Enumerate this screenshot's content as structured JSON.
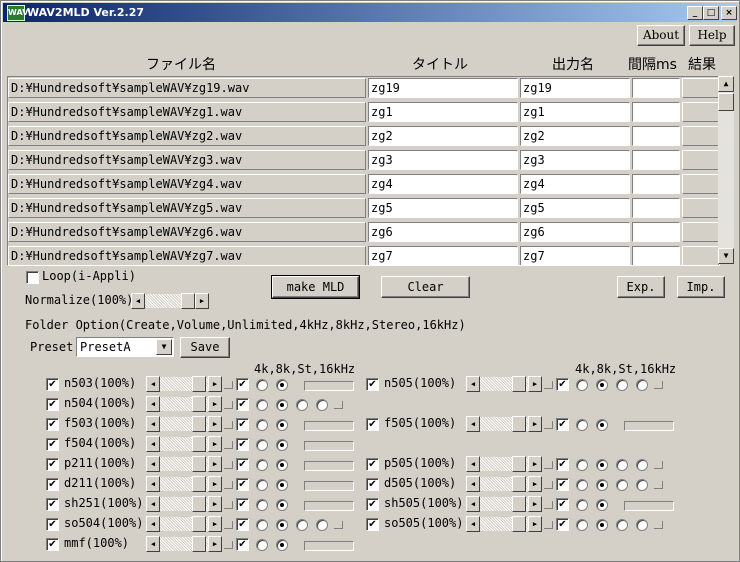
{
  "window": {
    "title": "WAV2MLD Ver.2.27",
    "icon_text": "WAV"
  },
  "controls": {
    "minimize": "_",
    "maximize": "□",
    "close": "×"
  },
  "menu": {
    "about": "About",
    "help": "Help"
  },
  "columns": {
    "file": "ファイル名",
    "title": "タイトル",
    "output": "出力名",
    "interval": "間隔ms",
    "result": "結果"
  },
  "files": [
    {
      "path": "D:¥Hundredsoft¥sampleWAV¥zg19.wav",
      "title": "zg19",
      "output": "zg19"
    },
    {
      "path": "D:¥Hundredsoft¥sampleWAV¥zg1.wav",
      "title": "zg1",
      "output": "zg1"
    },
    {
      "path": "D:¥Hundredsoft¥sampleWAV¥zg2.wav",
      "title": "zg2",
      "output": "zg2"
    },
    {
      "path": "D:¥Hundredsoft¥sampleWAV¥zg3.wav",
      "title": "zg3",
      "output": "zg3"
    },
    {
      "path": "D:¥Hundredsoft¥sampleWAV¥zg4.wav",
      "title": "zg4",
      "output": "zg4"
    },
    {
      "path": "D:¥Hundredsoft¥sampleWAV¥zg5.wav",
      "title": "zg5",
      "output": "zg5"
    },
    {
      "path": "D:¥Hundredsoft¥sampleWAV¥zg6.wav",
      "title": "zg6",
      "output": "zg6"
    },
    {
      "path": "D:¥Hundredsoft¥sampleWAV¥zg7.wav",
      "title": "zg7",
      "output": "zg7"
    }
  ],
  "options": {
    "loop_label": "Loop(i-Appli)",
    "normalize_label": "Normalize(100%)",
    "make_mld": "make MLD",
    "clear": "Clear",
    "exp": "Exp.",
    "imp": "Imp.",
    "folder_option": "Folder Option(Create,Volume,Unlimited,4kHz,8kHz,Stereo,16kHz)",
    "preset_label": "Preset",
    "preset_value": "PresetA",
    "save": "Save",
    "freq_header": "4k,8k,St,16kHz"
  },
  "left_devices": [
    {
      "name": "n503(100%)",
      "radios": 2,
      "sel": 1
    },
    {
      "name": "n504(100%)",
      "radios": 4,
      "sel": 1
    },
    {
      "name": "f503(100%)",
      "radios": 2,
      "sel": 1
    },
    {
      "name": "f504(100%)",
      "radios": 2,
      "sel": 1
    },
    {
      "name": "p211(100%)",
      "radios": 2,
      "sel": 1
    },
    {
      "name": "d211(100%)",
      "radios": 2,
      "sel": 1
    },
    {
      "name": "sh251(100%)",
      "radios": 2,
      "sel": 1
    },
    {
      "name": "so504(100%)",
      "radios": 4,
      "sel": 1
    },
    {
      "name": "mmf(100%)",
      "radios": 2,
      "sel": 1
    }
  ],
  "right_devices": [
    {
      "name": "n505(100%)",
      "row": 0,
      "radios": 4,
      "sel": 1
    },
    {
      "name": "f505(100%)",
      "row": 2,
      "radios": 2,
      "sel": 1
    },
    {
      "name": "p505(100%)",
      "row": 4,
      "radios": 4,
      "sel": 1
    },
    {
      "name": "d505(100%)",
      "row": 5,
      "radios": 4,
      "sel": 1
    },
    {
      "name": "sh505(100%)",
      "row": 6,
      "radios": 2,
      "sel": 1
    },
    {
      "name": "so505(100%)",
      "row": 7,
      "radios": 4,
      "sel": 1
    }
  ]
}
